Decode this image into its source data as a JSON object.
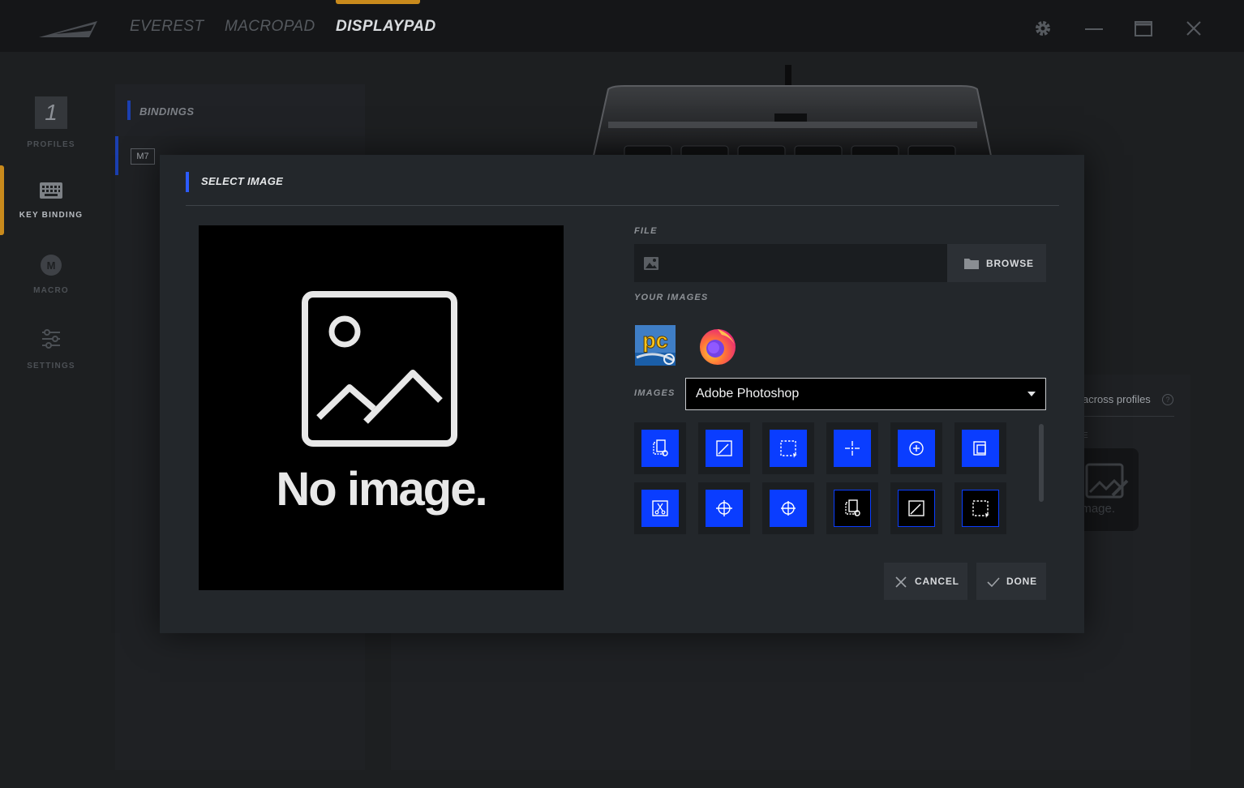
{
  "titlebar": {
    "tabs": [
      "EVEREST",
      "MACROPAD",
      "DISPLAYPAD"
    ],
    "active_tab": "DISPLAYPAD"
  },
  "nav": {
    "profile_number": "1",
    "items": [
      {
        "label": "PROFILES",
        "icon": "profile-number"
      },
      {
        "label": "KEY BINDING",
        "icon": "keyboard-icon"
      },
      {
        "label": "MACRO",
        "icon": "macro-icon"
      },
      {
        "label": "SETTINGS",
        "icon": "sliders-icon"
      }
    ],
    "active_item": "KEY BINDING"
  },
  "bindings": {
    "title": "BINDINGS",
    "row_badge": "M7"
  },
  "background_panel": {
    "across_profiles_text": "across profiles",
    "help_symbol": "?",
    "section_letter": "E",
    "key_placeholder_text": "image."
  },
  "modal": {
    "title": "SELECT IMAGE",
    "preview_text": "No image.",
    "file_label": "FILE",
    "file_value": "",
    "browse_label": "BROWSE",
    "your_images_label": "YOUR IMAGES",
    "your_images": [
      {
        "name": "pc-app-icon",
        "text": "pc"
      },
      {
        "name": "firefox-icon",
        "text": ""
      }
    ],
    "images_label": "IMAGES",
    "images_selected": "Adobe Photoshop",
    "cancel_label": "CANCEL",
    "done_label": "DONE"
  },
  "colors": {
    "accent_blue": "#2c5bff",
    "tile_blue": "#0a3dff",
    "accent_orange": "#c98a1c",
    "modal_bg": "#23272b"
  }
}
